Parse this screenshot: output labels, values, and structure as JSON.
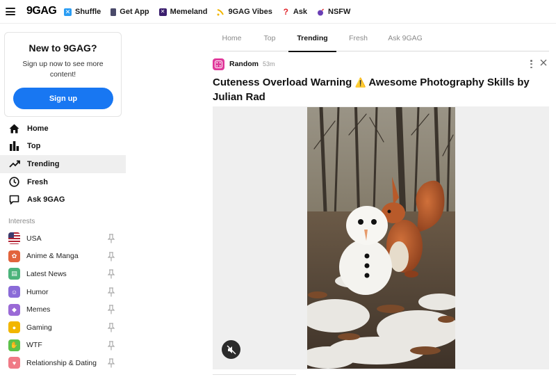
{
  "topbar": {
    "logo": "9GAG",
    "nav": [
      {
        "label": "Shuffle",
        "icon": "shuffle-icon",
        "color": "#2a9df4"
      },
      {
        "label": "Get App",
        "icon": "phone-icon",
        "color": "#4a4a6a"
      },
      {
        "label": "Memeland",
        "icon": "memeland-icon",
        "color": "#3b1f6e"
      },
      {
        "label": "9GAG Vibes",
        "icon": "vibes-icon",
        "color": "#f2b600"
      },
      {
        "label": "Ask",
        "icon": "question-icon",
        "color": "#e0242b"
      },
      {
        "label": "NSFW",
        "icon": "bomb-icon",
        "color": "#6a3fb5"
      }
    ]
  },
  "promo": {
    "title": "New to 9GAG?",
    "text": "Sign up now to see more content!",
    "button": "Sign up"
  },
  "sidebar_nav": [
    {
      "label": "Home",
      "icon": "home-icon"
    },
    {
      "label": "Top",
      "icon": "bar-chart-icon"
    },
    {
      "label": "Trending",
      "icon": "trending-icon",
      "active": true
    },
    {
      "label": "Fresh",
      "icon": "clock-icon"
    },
    {
      "label": "Ask 9GAG",
      "icon": "speech-bubble-icon"
    }
  ],
  "interests": {
    "heading": "Interests",
    "items": [
      {
        "label": "USA",
        "icon": "us-flag-icon",
        "color": "#b22234"
      },
      {
        "label": "Anime & Manga",
        "icon": "anime-icon",
        "color": "#e2643c"
      },
      {
        "label": "Latest News",
        "icon": "news-icon",
        "color": "#4bb37a"
      },
      {
        "label": "Humor",
        "icon": "humor-icon",
        "color": "#8a6bd8"
      },
      {
        "label": "Memes",
        "icon": "gem-icon",
        "color": "#9a6ad6"
      },
      {
        "label": "Gaming",
        "icon": "gamepad-icon",
        "color": "#f2b600"
      },
      {
        "label": "WTF",
        "icon": "wtf-icon",
        "color": "#5cc24a"
      },
      {
        "label": "Relationship & Dating",
        "icon": "heart-icon",
        "color": "#f07a86"
      }
    ]
  },
  "tabs": [
    {
      "label": "Home"
    },
    {
      "label": "Top"
    },
    {
      "label": "Trending",
      "active": true
    },
    {
      "label": "Fresh"
    },
    {
      "label": "Ask 9GAG"
    }
  ],
  "post": {
    "category": "Random",
    "age": "53m",
    "title_part1": "Cuteness Overload Warning",
    "warning_emoji": "⚠️",
    "title_part2": "Awesome Photography Skills by Julian Rad",
    "category_color": "#e03a9b"
  }
}
